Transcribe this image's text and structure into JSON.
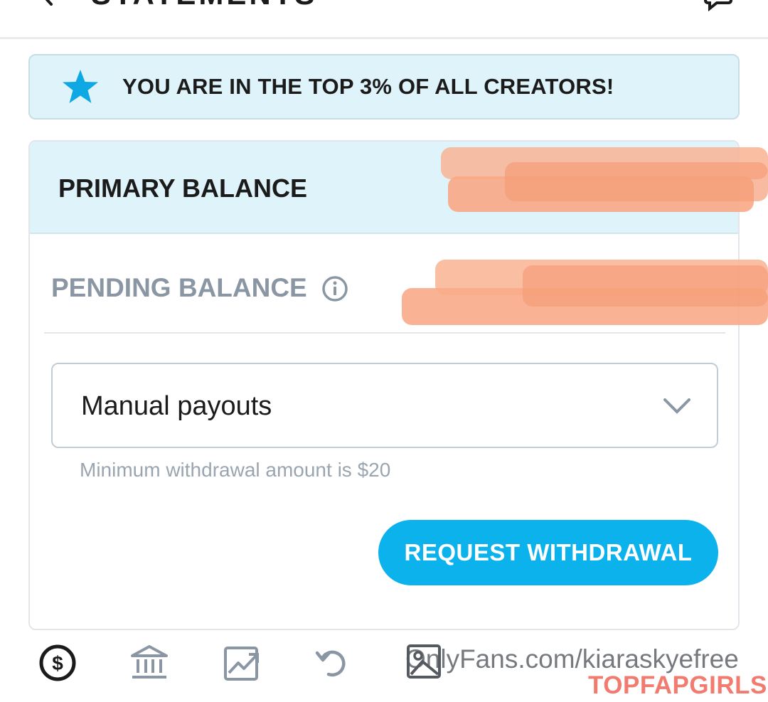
{
  "header": {
    "title": "STATEMENTS",
    "back_icon": "arrow-left-icon",
    "action_icon": "chat-icon"
  },
  "banner": {
    "icon": "star-icon",
    "text": "YOU ARE IN THE TOP 3% OF ALL CREATORS!"
  },
  "balance": {
    "primary_label": "PRIMARY BALANCE",
    "pending_label": "PENDING BALANCE",
    "pending_info_icon": "info-icon"
  },
  "payout": {
    "selected": "Manual payouts",
    "hint": "Minimum withdrawal amount is $20",
    "button_label": "REQUEST WITHDRAWAL"
  },
  "bottom_nav": {
    "items": [
      "dollar-circle-icon",
      "bank-icon",
      "chart-icon",
      "refresh-icon",
      "image-icon"
    ]
  },
  "watermarks": {
    "url": "OnlyFans.com/kiaraskyefree",
    "brand": "TOPFAPGIRLS"
  },
  "colors": {
    "accent": "#0cb2ec",
    "banner_bg": "#dff4fa",
    "muted_text": "#8a96a3",
    "redaction": "#f7a37f"
  }
}
